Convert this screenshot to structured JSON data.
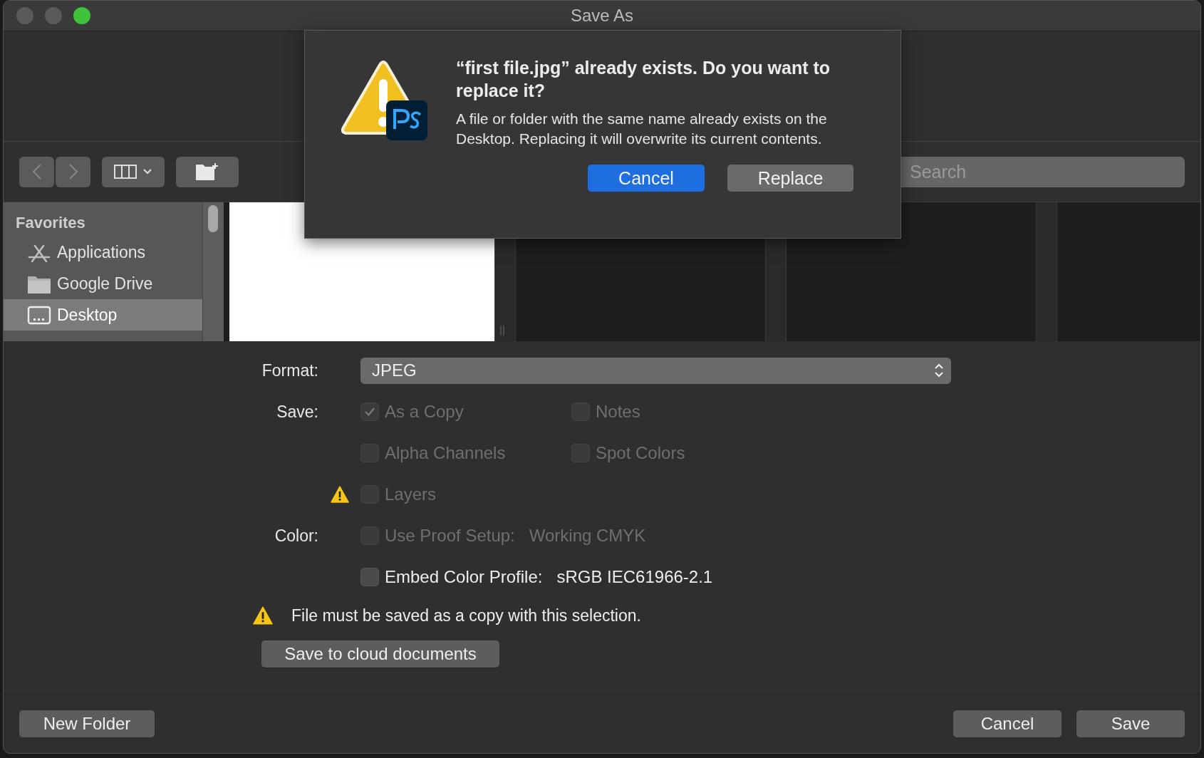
{
  "window": {
    "title": "Save As"
  },
  "toolbar": {
    "search": {
      "placeholder": "Search"
    }
  },
  "sidebar": {
    "heading": "Favorites",
    "items": [
      {
        "label": "Applications",
        "kind": "apps",
        "selected": false
      },
      {
        "label": "Google Drive",
        "kind": "folder",
        "selected": false
      },
      {
        "label": "Desktop",
        "kind": "desktop",
        "selected": true
      }
    ]
  },
  "options": {
    "format": {
      "label": "Format:",
      "value": "JPEG"
    },
    "rows": [
      {
        "label": "Save:",
        "warning": false,
        "checkboxes": [
          {
            "label": "As a Copy",
            "checked": true,
            "disabled": true
          },
          {
            "label": "Notes",
            "checked": false,
            "disabled": true
          }
        ]
      },
      {
        "warning": false,
        "checkboxes": [
          {
            "label": "Alpha Channels",
            "checked": false,
            "disabled": true
          },
          {
            "label": "Spot Colors",
            "checked": false,
            "disabled": true
          }
        ]
      },
      {
        "warning": true,
        "checkboxes": [
          {
            "label": "Layers",
            "checked": false,
            "disabled": true
          }
        ]
      },
      {
        "label": "Color:",
        "warning": false,
        "checkboxes": [
          {
            "label": "Use Proof Setup:",
            "value": "Working CMYK",
            "checked": false,
            "disabled": true
          }
        ]
      },
      {
        "warning": false,
        "checkboxes": [
          {
            "label": "Embed Color Profile:",
            "value": "sRGB IEC61966-2.1",
            "checked": false,
            "disabled": false
          }
        ]
      }
    ],
    "notice": "File must be saved as a copy with this selection.",
    "cloud_button": "Save to cloud documents"
  },
  "footer": {
    "new_folder": "New Folder",
    "cancel": "Cancel",
    "save": "Save"
  },
  "alert": {
    "title": "“first file.jpg” already exists. Do you want to replace it?",
    "message": "A file or folder with the same name already exists on the Desktop. Replacing it will overwrite its current contents.",
    "buttons": [
      {
        "label": "Cancel",
        "default": true
      },
      {
        "label": "Replace",
        "default": false
      }
    ]
  }
}
